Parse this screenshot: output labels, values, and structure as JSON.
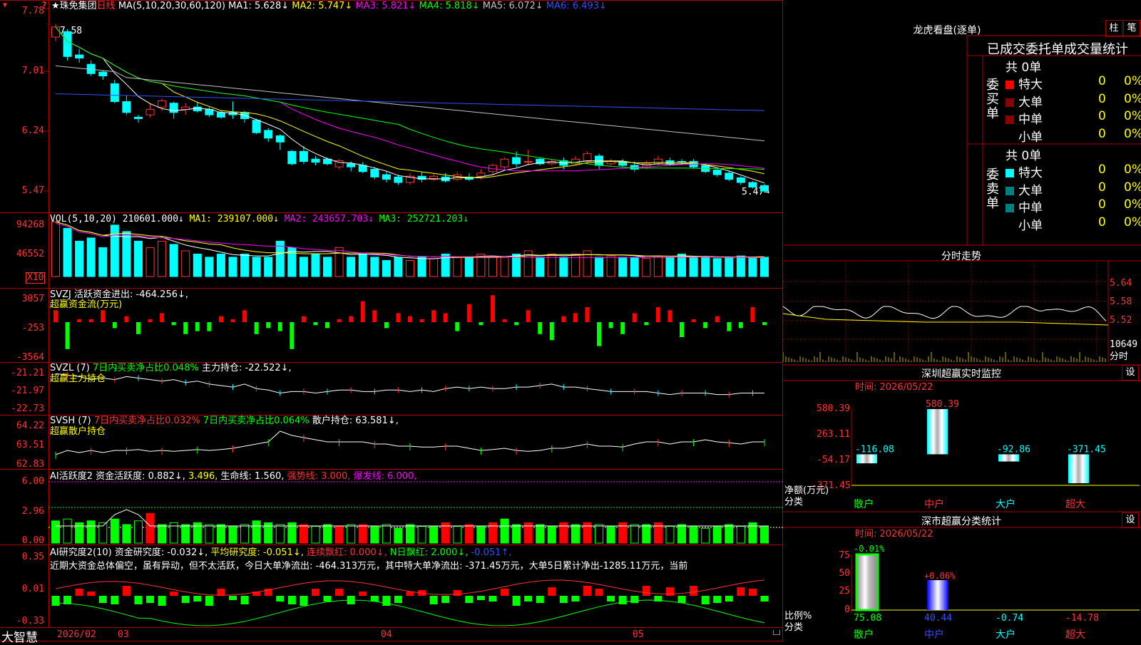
{
  "stock": {
    "star": "★",
    "name": "珠免集团",
    "period": "日线"
  },
  "ma_header": {
    "label": "MA(5,10,20,30,60,120)",
    "ma1": "MA1: 5.628↓",
    "ma2": "MA2: 5.747↓",
    "ma3": "MA3: 5.821↓",
    "ma4": "MA4: 5.818↓",
    "ma5": "MA5: 6.072↓",
    "ma6": "MA6: 6.493↓"
  },
  "price_axis": [
    "7.78",
    "7.01",
    "6.24",
    "5.47"
  ],
  "price_hi_note": "7.58",
  "price_lo_note": "5.47",
  "vol_header": {
    "label": "VOL(5,10,20)",
    "value": "210601.000↓",
    "ma1": "MA1: 239107.000↓",
    "ma2": "MA2: 243657.703↓",
    "ma3": "MA3: 252721.203↓"
  },
  "vol_axis": [
    "94268",
    "46552"
  ],
  "vol_unit": "X10",
  "svzj_header": {
    "label": "SVZJ",
    "text": "活跃资金进出: -464.256↓,",
    "sub": "超赢资金流(万元)"
  },
  "svzj_axis": [
    "3057",
    "-253",
    "-3564"
  ],
  "svzl_header": {
    "label": "SVZL (7)",
    "a": "7日内买卖净占比0.048%",
    "b": "主力持仓: -22.522↓,",
    "sub": "超赢主力持仓"
  },
  "svzl_axis": [
    "-21.21",
    "-21.97",
    "-22.73"
  ],
  "svsh_header": {
    "label": "SVSH (7)",
    "a": "7日内买卖净占比0.032%",
    "b": "7日内买卖净占比0.064%",
    "c": "散户持仓: 63.581↓,",
    "sub": "超赢散户持仓"
  },
  "svsh_axis": [
    "64.22",
    "63.51",
    "62.83"
  ],
  "ai1_header": {
    "label": "AI活跃度2",
    "a": "资金活跃度: 0.882↓,",
    "b": "3.496,",
    "c": "生命线: 1.560,",
    "d": "强势线: 3.000,",
    "e": "爆发线: 6.000,"
  },
  "ai1_axis": [
    "6.00",
    "2.96",
    "0.00"
  ],
  "ai2_header": {
    "label": "AI研究度2(10)",
    "a": "资金研究度: -0.032↓,",
    "b": "平均研究度: -0.051↓,",
    "c": "连续飘红: 0.000↓,",
    "d": "N日飘红: 2.000↓,",
    "e": "-0.051↑,"
  },
  "ai2_axis": [
    "0.35",
    "0.01",
    "-0.33"
  ],
  "ai2_comment": "近期大资金总体偏空，虽有异动，但不太活跃，今日大单净流出: -464.313万元，其中特大单净流出: -371.45万元，大单5日累计净出-1285.11万元，当前",
  "date_axis": [
    "2026/02",
    "03",
    "04",
    "05"
  ],
  "brand": "大智慧",
  "right_panel": {
    "longhu_title": "龙虎看盘(逐单)",
    "btn_zhu": "柱",
    "btn_bi": "笔",
    "tabs": "已成交委托单成交量统计",
    "buy_label": "委买单",
    "sell_label": "委卖单",
    "buy_total": "共 0单",
    "sell_total": "共 0单",
    "rows": [
      {
        "name": "特大",
        "count": "0",
        "pct": "0%"
      },
      {
        "name": "大单",
        "count": "0",
        "pct": "0%"
      },
      {
        "name": "中单",
        "count": "0",
        "pct": "0%"
      },
      {
        "name": "小单",
        "count": "0",
        "pct": "0%"
      }
    ],
    "fenshi_title": "分时走势",
    "fenshi_axis": [
      "5.64",
      "5.58",
      "5.52"
    ],
    "fenshi_vol": "10649",
    "fenshi_unit": "分时",
    "monitor_title": "深圳超赢实时监控",
    "set_label": "设",
    "monitor_time": "时间: 2026/05/22",
    "monitor_axis": [
      "580.39",
      "263.11",
      "-54.17",
      "-371.45"
    ],
    "monitor_ylabel": "净额(万元)",
    "monitor_xlabel": "分类",
    "stat_title": "深市超赢分类统计",
    "stat_time": "时间: 2026/05/22",
    "stat_axis": [
      "75",
      "50",
      "25",
      "0"
    ],
    "stat_ylabel": "比例%",
    "stat_xlabel": "分类"
  },
  "monitor_chart": {
    "type": "bar",
    "categories": [
      "散户",
      "中户",
      "大户",
      "超大"
    ],
    "values": [
      -116.08,
      580.39,
      -92.86,
      -371.45
    ],
    "ylim": [
      -371.45,
      580.39
    ]
  },
  "stat_chart": {
    "type": "bar",
    "categories": [
      "散户",
      "中户",
      "大户",
      "超大"
    ],
    "values": [
      75.08,
      40.44,
      -0.74,
      -14.78
    ],
    "top_labels": [
      "-0.01%",
      "+0.06%",
      "",
      ""
    ],
    "ylim": [
      0,
      75
    ]
  },
  "chart_data": {
    "type": "candlestick",
    "ylim": [
      5.47,
      7.78
    ],
    "candles": [
      [
        7.45,
        7.58,
        7.4,
        7.62
      ],
      [
        7.52,
        7.2,
        7.15,
        7.55
      ],
      [
        7.22,
        7.18,
        7.12,
        7.3
      ],
      [
        7.1,
        6.98,
        6.95,
        7.15
      ],
      [
        7.0,
        6.95,
        6.9,
        7.02
      ],
      [
        6.85,
        6.62,
        6.6,
        6.9
      ],
      [
        6.62,
        6.48,
        6.45,
        6.7
      ],
      [
        6.42,
        6.4,
        6.35,
        6.45
      ],
      [
        6.45,
        6.52,
        6.42,
        6.6
      ],
      [
        6.55,
        6.63,
        6.5,
        6.66
      ],
      [
        6.6,
        6.48,
        6.4,
        6.62
      ],
      [
        6.52,
        6.55,
        6.45,
        6.6
      ],
      [
        6.55,
        6.5,
        6.48,
        6.62
      ],
      [
        6.52,
        6.45,
        6.42,
        6.55
      ],
      [
        6.48,
        6.42,
        6.4,
        6.5
      ],
      [
        6.48,
        6.45,
        6.4,
        6.62
      ],
      [
        6.48,
        6.4,
        6.35,
        6.5
      ],
      [
        6.38,
        6.22,
        6.2,
        6.4
      ],
      [
        6.25,
        6.15,
        6.1,
        6.28
      ],
      [
        6.18,
        6.1,
        6.0,
        6.2
      ],
      [
        5.98,
        5.82,
        5.8,
        6.0
      ],
      [
        5.98,
        5.85,
        5.82,
        6.05
      ],
      [
        5.88,
        5.84,
        5.8,
        5.92
      ],
      [
        5.88,
        5.82,
        5.8,
        5.9
      ],
      [
        5.78,
        5.86,
        5.75,
        5.88
      ],
      [
        5.82,
        5.78,
        5.72,
        5.85
      ],
      [
        5.8,
        5.72,
        5.7,
        5.84
      ],
      [
        5.75,
        5.65,
        5.62,
        5.78
      ],
      [
        5.68,
        5.62,
        5.58,
        5.72
      ],
      [
        5.65,
        5.58,
        5.55,
        5.68
      ],
      [
        5.58,
        5.66,
        5.55,
        5.7
      ],
      [
        5.66,
        5.62,
        5.58,
        5.72
      ],
      [
        5.62,
        5.66,
        5.6,
        5.7
      ],
      [
        5.65,
        5.6,
        5.58,
        5.7
      ],
      [
        5.62,
        5.68,
        5.6,
        5.72
      ],
      [
        5.65,
        5.62,
        5.6,
        5.7
      ],
      [
        5.66,
        5.7,
        5.62,
        5.75
      ],
      [
        5.72,
        5.8,
        5.68,
        5.82
      ],
      [
        5.78,
        5.88,
        5.75,
        5.9
      ],
      [
        5.9,
        5.82,
        5.78,
        5.98
      ],
      [
        5.85,
        5.85,
        5.8,
        6.0
      ],
      [
        5.88,
        5.82,
        5.8,
        5.9
      ],
      [
        5.82,
        5.85,
        5.8,
        5.88
      ],
      [
        5.86,
        5.8,
        5.75,
        5.9
      ],
      [
        5.82,
        5.88,
        5.8,
        5.92
      ],
      [
        5.85,
        5.95,
        5.82,
        5.98
      ],
      [
        5.92,
        5.8,
        5.75,
        5.95
      ],
      [
        5.82,
        5.85,
        5.8,
        5.88
      ],
      [
        5.85,
        5.8,
        5.78,
        5.88
      ],
      [
        5.8,
        5.75,
        5.72,
        5.85
      ],
      [
        5.78,
        5.82,
        5.75,
        5.86
      ],
      [
        5.82,
        5.88,
        5.8,
        5.92
      ],
      [
        5.86,
        5.82,
        5.8,
        5.9
      ],
      [
        5.85,
        5.84,
        5.8,
        5.88
      ],
      [
        5.85,
        5.78,
        5.76,
        5.88
      ],
      [
        5.8,
        5.72,
        5.7,
        5.82
      ],
      [
        5.74,
        5.68,
        5.65,
        5.75
      ],
      [
        5.7,
        5.62,
        5.6,
        5.72
      ],
      [
        5.64,
        5.58,
        5.55,
        5.66
      ],
      [
        5.58,
        5.52,
        5.5,
        5.6
      ],
      [
        5.54,
        5.47,
        5.45,
        5.56
      ]
    ]
  }
}
